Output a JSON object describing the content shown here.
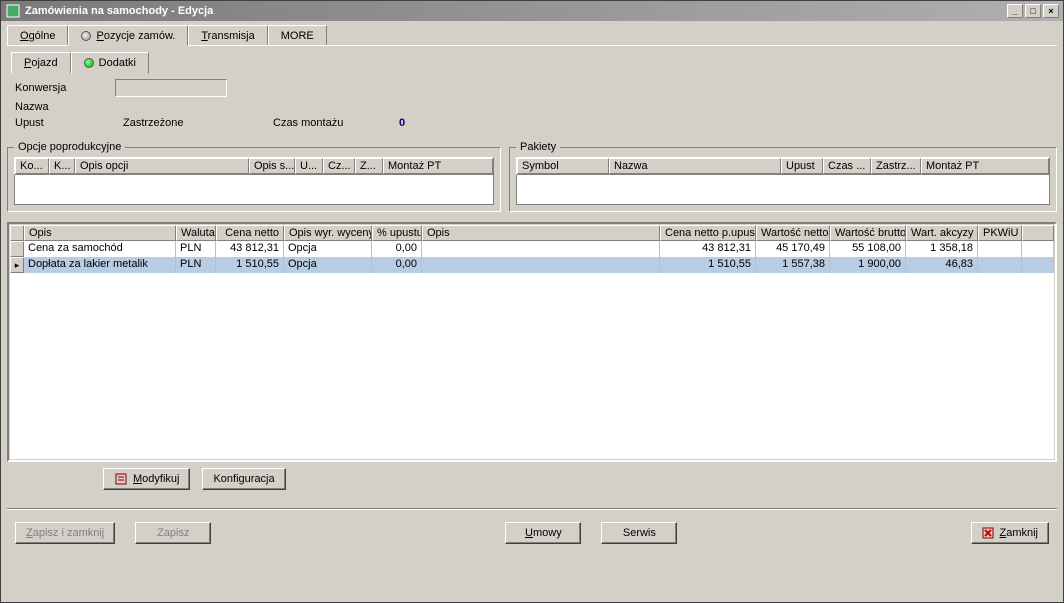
{
  "title": "Zamówienia na samochody - Edycja",
  "tabs": {
    "t0": "Ogólne",
    "t1": "Pozycje zamów.",
    "t2": "Transmisja",
    "t3": "MORE"
  },
  "subtabs": {
    "s0": "Pojazd",
    "s1": "Dodatki"
  },
  "form": {
    "conversion_label": "Konwersja",
    "name_label": "Nazwa",
    "discount_label": "Upust",
    "reserved_label": "Zastrzeżone",
    "assembly_label": "Czas montażu",
    "assembly_value": "0"
  },
  "postprod": {
    "legend": "Opcje poprodukcyjne",
    "cols": {
      "c0": "Ko...",
      "c1": "K...",
      "c2": "Opis opcji",
      "c3": "Opis s...",
      "c4": "U...",
      "c5": "Cz...",
      "c6": "Z...",
      "c7": "Montaż PT"
    }
  },
  "packages": {
    "legend": "Pakiety",
    "cols": {
      "c0": "Symbol",
      "c1": "Nazwa",
      "c2": "Upust",
      "c3": "Czas ...",
      "c4": "Zastrz...",
      "c5": "Montaż PT"
    }
  },
  "grid": {
    "cols": {
      "c0": "Opis",
      "c1": "Waluta",
      "c2": "Cena netto",
      "c3": "Opis wyr. wyceny",
      "c4": "% upustu",
      "c5": "Opis",
      "c6": "Cena netto p.upust",
      "c7": "Wartość netto",
      "c8": "Wartość brutto",
      "c9": "Wart. akcyzy",
      "c10": "PKWiU"
    },
    "r0": {
      "opis": "Cena za samochód",
      "waluta": "PLN",
      "cena": "43 812,31",
      "wyr": "Opcja",
      "upust": "0,00",
      "opis2": "",
      "pu": "43 812,31",
      "wn": "45 170,49",
      "wb": "55 108,00",
      "ak": "1 358,18",
      "pk": ""
    },
    "r1": {
      "opis": "Dopłata za lakier metalik",
      "waluta": "PLN",
      "cena": "1 510,55",
      "wyr": "Opcja",
      "upust": "0,00",
      "opis2": "",
      "pu": "1 510,55",
      "wn": "1 557,38",
      "wb": "1 900,00",
      "ak": "46,83",
      "pk": ""
    }
  },
  "buttons": {
    "modify": "Modyfikuj",
    "config": "Konfiguracja",
    "save_close": "Zapisz i zamknij",
    "save": "Zapisz",
    "contracts": "Umowy",
    "service": "Serwis",
    "close": "Zamknij"
  }
}
